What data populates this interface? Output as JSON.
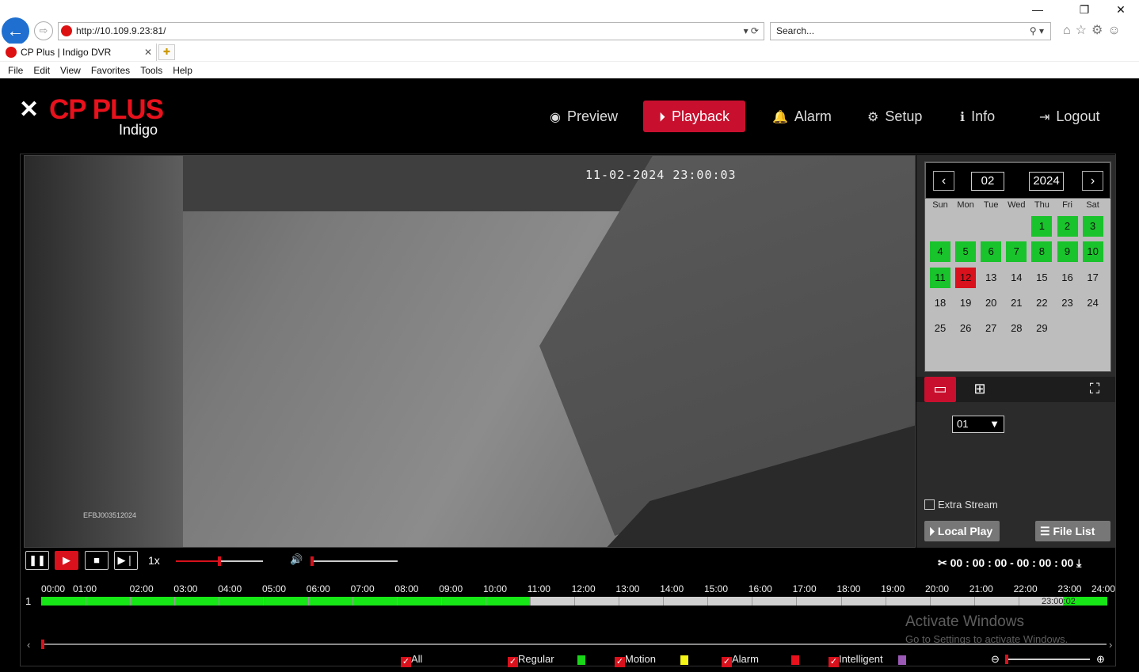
{
  "browser": {
    "address": "http://10.109.9.23:81/",
    "search_placeholder": "Search...",
    "tab_title": "CP Plus | Indigo DVR",
    "menu": [
      "File",
      "Edit",
      "View",
      "Favorites",
      "Tools",
      "Help"
    ]
  },
  "app": {
    "brand": "CP PLUS",
    "sub": "Indigo",
    "nav": [
      {
        "label": "Preview",
        "icon": "eye-icon"
      },
      {
        "label": "Playback",
        "icon": "play-circle-icon",
        "active": true
      },
      {
        "label": "Alarm",
        "icon": "bell-icon"
      },
      {
        "label": "Setup",
        "icon": "gear-icon"
      },
      {
        "label": "Info",
        "icon": "info-icon"
      },
      {
        "label": "Logout",
        "icon": "logout-icon"
      }
    ]
  },
  "video": {
    "osd_time": "11-02-2024 23:00:03",
    "serial": "EFBJ003512024"
  },
  "calendar": {
    "month": "02",
    "year": "2024",
    "dow": [
      "Sun",
      "Mon",
      "Tue",
      "Wed",
      "Thu",
      "Fri",
      "Sat"
    ],
    "days": [
      "1",
      "2",
      "3",
      "4",
      "5",
      "6",
      "7",
      "8",
      "9",
      "10",
      "11",
      "12",
      "13",
      "14",
      "15",
      "16",
      "17",
      "18",
      "19",
      "20",
      "21",
      "22",
      "23",
      "24",
      "25",
      "26",
      "27",
      "28",
      "29"
    ],
    "record_days": [
      1,
      2,
      3,
      4,
      5,
      6,
      7,
      8,
      9,
      10,
      11
    ],
    "selected_day": 12,
    "first_weekday": 4
  },
  "channel": {
    "selected": "01"
  },
  "extra_stream": "Extra Stream",
  "buttons": {
    "local_play": "Local Play",
    "file_list": "File List"
  },
  "controls": {
    "speed": "1x",
    "timecode": "00 : 00 : 00 - 00 : 00 : 00",
    "progress": 0.5,
    "volume": 0.0
  },
  "timeline": {
    "hours": [
      "00:00",
      "01:00",
      "02:00",
      "03:00",
      "04:00",
      "05:00",
      "06:00",
      "07:00",
      "08:00",
      "09:00",
      "10:00",
      "11:00",
      "12:00",
      "13:00",
      "14:00",
      "15:00",
      "16:00",
      "17:00",
      "18:00",
      "19:00",
      "20:00",
      "21:00",
      "22:00",
      "23:00",
      "24:00"
    ],
    "channel": "1",
    "cursor": "23:00:02",
    "recorded": [
      [
        0,
        11
      ],
      [
        23,
        24
      ]
    ]
  },
  "legend": [
    {
      "label": "All"
    },
    {
      "label": "Regular",
      "color": "#19d619"
    },
    {
      "label": "Motion",
      "color": "#f5f516"
    },
    {
      "label": "Alarm",
      "color": "#e8111c"
    },
    {
      "label": "Intelligent",
      "color": "#9b59b6"
    }
  ],
  "watermark": {
    "line1": "Activate Windows",
    "line2": "Go to Settings to activate Windows."
  }
}
